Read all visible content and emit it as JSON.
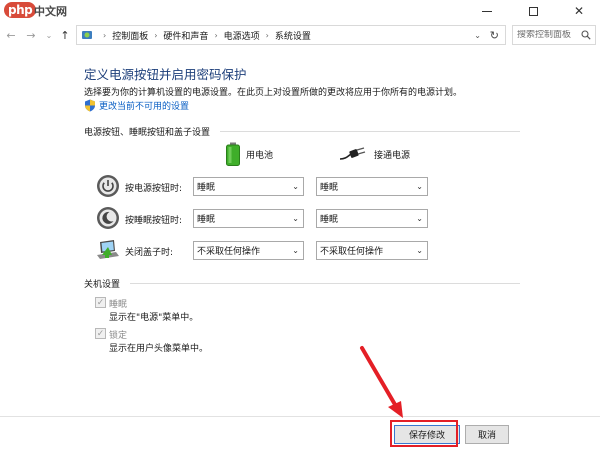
{
  "watermark": {
    "logo_text": "php",
    "logo_suffix": "中文网"
  },
  "address_bar": {
    "breadcrumbs": [
      "控制面板",
      "硬件和声音",
      "电源选项",
      "系统设置"
    ],
    "search_placeholder": "搜索控制面板"
  },
  "page": {
    "title": "定义电源按钮并启用密码保护",
    "description": "选择要为你的计算机设置的电源设置。在此页上对设置所做的更改将应用于你所有的电源计划。",
    "change_link": "更改当前不可用的设置"
  },
  "power_section": {
    "title": "电源按钮、睡眠按钮和盖子设置",
    "columns": {
      "battery": "用电池",
      "plugged_in": "接通电源"
    },
    "rows": [
      {
        "label": "按电源按钮时:",
        "battery": "睡眠",
        "plugged_in": "睡眠"
      },
      {
        "label": "按睡眠按钮时:",
        "battery": "睡眠",
        "plugged_in": "睡眠"
      },
      {
        "label": "关闭盖子时:",
        "battery": "不采取任何操作",
        "plugged_in": "不采取任何操作"
      }
    ]
  },
  "shutdown_section": {
    "title": "关机设置",
    "items": [
      {
        "label": "睡眠",
        "description": "显示在\"电源\"菜单中。",
        "checked": true
      },
      {
        "label": "锁定",
        "description": "显示在用户头像菜单中。",
        "checked": true
      }
    ]
  },
  "footer": {
    "save_label": "保存修改",
    "cancel_label": "取消"
  },
  "colors": {
    "heading": "#1c3e7a",
    "link": "#0a5fc4",
    "highlight": "#e41f26",
    "battery_green": "#3fae2a"
  }
}
